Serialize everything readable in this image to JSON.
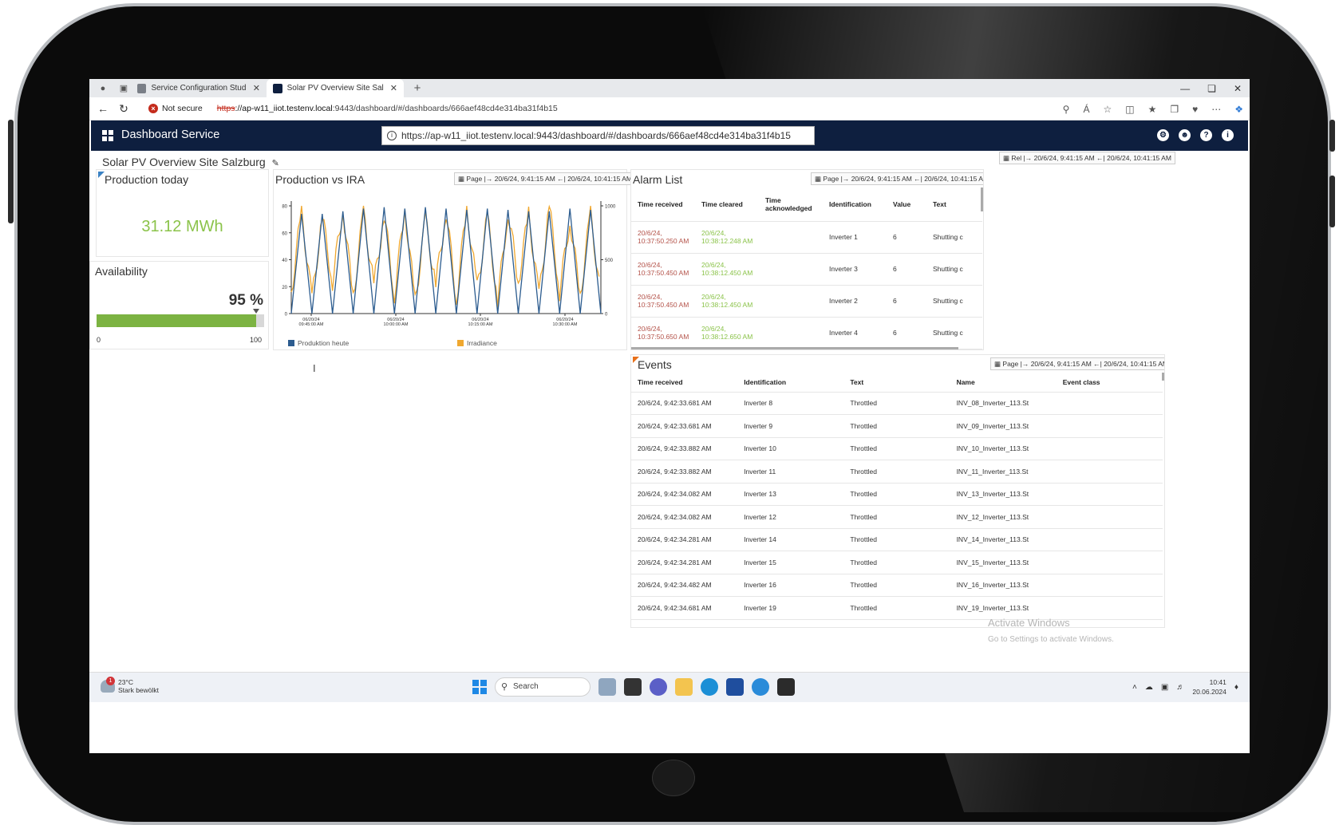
{
  "browser": {
    "tabs": [
      {
        "label": "Service Configuration Studio - lio",
        "active": false
      },
      {
        "label": "Solar PV Overview Site Salzburg",
        "active": true
      }
    ],
    "new_tab": "+",
    "not_secure": "Not secure",
    "url_scheme": "https",
    "url_host": "://ap-w11_iiot.testenv.local",
    "url_rest": ":9443/dashboard/#/dashboards/666aef48cd4e314ba31f4b15"
  },
  "app": {
    "title": "Dashboard Service",
    "url_popup": "https://ap-w11_iiot.testenv.local:9443/dashboard/#/dashboards/666aef48cd4e314ba31f4b15",
    "page_title": "Solar PV Overview Site Salzburg",
    "global_range": "Rel |→ 20/6/24, 9:41:15 AM ←| 20/6/24, 10:41:15 AM"
  },
  "production_today": {
    "title": "Production today",
    "value": "31.12 MWh"
  },
  "availability": {
    "title": "Availability",
    "value": "95 %",
    "percent": 95,
    "min": "0",
    "max": "100"
  },
  "production_chart": {
    "title": "Production vs IRA",
    "range": "Page |→ 20/6/24, 9:41:15 AM ←| 20/6/24, 10:41:15 AM"
  },
  "chart_data": {
    "type": "line",
    "title": "Production vs IRA",
    "x_ticks": [
      "06/20/24 09:45:00 AM",
      "06/20/24 10:00:00 AM",
      "06/20/24 10:15:00 AM",
      "06/20/24 10:30:00 AM"
    ],
    "y_left_ticks": [
      "0",
      "20",
      "40",
      "60",
      "80"
    ],
    "y_right_ticks": [
      "0",
      "500",
      "1000"
    ],
    "y_left_range": [
      0,
      80
    ],
    "y_right_range": [
      0,
      1000
    ],
    "series": [
      {
        "name": "Produktion heute",
        "color": "#2c5c8f",
        "axis": "left",
        "values": [
          0,
          74,
          0,
          74,
          0,
          76,
          0,
          78,
          0,
          79,
          0,
          78,
          0,
          79,
          0,
          78,
          0,
          77,
          0,
          78,
          0,
          77,
          0,
          76,
          0,
          76,
          0,
          78,
          0,
          77,
          0
        ]
      },
      {
        "name": "Irradiance",
        "color": "#f0a830",
        "axis": "right",
        "values": [
          200,
          950,
          120,
          900,
          300,
          980,
          150,
          950,
          250,
          920,
          180,
          980,
          100,
          870,
          260,
          960,
          140,
          990,
          220,
          900,
          110,
          960,
          300,
          920,
          150,
          1000,
          200,
          880,
          160,
          940,
          120
        ]
      }
    ],
    "legend_position": "bottom",
    "grid": false
  },
  "alarm_list": {
    "title": "Alarm List",
    "range": "Page |→ 20/6/24, 9:41:15 AM ←| 20/6/24, 10:41:15 AM",
    "columns": [
      "Time received",
      "Time cleared",
      "Time acknowledged",
      "Identification",
      "Value",
      "Text"
    ],
    "rows": [
      {
        "received": "20/6/24, 10:37:50.250 AM",
        "cleared": "20/6/24, 10:38:12.248 AM",
        "ack": "",
        "id": "Inverter 1",
        "value": "6",
        "text": "Shutting c"
      },
      {
        "received": "20/6/24, 10:37:50.450 AM",
        "cleared": "20/6/24, 10:38:12.450 AM",
        "ack": "",
        "id": "Inverter 3",
        "value": "6",
        "text": "Shutting c"
      },
      {
        "received": "20/6/24, 10:37:50.450 AM",
        "cleared": "20/6/24, 10:38:12.450 AM",
        "ack": "",
        "id": "Inverter 2",
        "value": "6",
        "text": "Shutting c"
      },
      {
        "received": "20/6/24, 10:37:50.650 AM",
        "cleared": "20/6/24, 10:38:12.650 AM",
        "ack": "",
        "id": "Inverter 4",
        "value": "6",
        "text": "Shutting c"
      }
    ]
  },
  "events": {
    "title": "Events",
    "range": "Page |→ 20/6/24, 9:41:15 AM ←| 20/6/24, 10:41:15 AM",
    "columns": [
      "Time received",
      "Identification",
      "Text",
      "Name",
      "Event class"
    ],
    "rows": [
      {
        "time": "20/6/24, 9:42:33.681 AM",
        "id": "Inverter 8",
        "text": "Throttled",
        "name": "INV_08_Inverter_113.St",
        "cls": ""
      },
      {
        "time": "20/6/24, 9:42:33.681 AM",
        "id": "Inverter 9",
        "text": "Throttled",
        "name": "INV_09_Inverter_113.St",
        "cls": ""
      },
      {
        "time": "20/6/24, 9:42:33.882 AM",
        "id": "Inverter 10",
        "text": "Throttled",
        "name": "INV_10_Inverter_113.St",
        "cls": ""
      },
      {
        "time": "20/6/24, 9:42:33.882 AM",
        "id": "Inverter 11",
        "text": "Throttled",
        "name": "INV_11_Inverter_113.St",
        "cls": ""
      },
      {
        "time": "20/6/24, 9:42:34.082 AM",
        "id": "Inverter 13",
        "text": "Throttled",
        "name": "INV_13_Inverter_113.St",
        "cls": ""
      },
      {
        "time": "20/6/24, 9:42:34.082 AM",
        "id": "Inverter 12",
        "text": "Throttled",
        "name": "INV_12_Inverter_113.St",
        "cls": ""
      },
      {
        "time": "20/6/24, 9:42:34.281 AM",
        "id": "Inverter 14",
        "text": "Throttled",
        "name": "INV_14_Inverter_113.St",
        "cls": ""
      },
      {
        "time": "20/6/24, 9:42:34.281 AM",
        "id": "Inverter 15",
        "text": "Throttled",
        "name": "INV_15_Inverter_113.St",
        "cls": ""
      },
      {
        "time": "20/6/24, 9:42:34.482 AM",
        "id": "Inverter 16",
        "text": "Throttled",
        "name": "INV_16_Inverter_113.St",
        "cls": ""
      },
      {
        "time": "20/6/24, 9:42:34.681 AM",
        "id": "Inverter 19",
        "text": "Throttled",
        "name": "INV_19_Inverter_113.St",
        "cls": ""
      }
    ]
  },
  "watermark": {
    "line1": "Activate Windows",
    "line2": "Go to Settings to activate Windows."
  },
  "taskbar": {
    "weather_temp": "23°C",
    "weather_desc": "Stark bewölkt",
    "weather_badge": "1",
    "search": "Search",
    "time": "10:41",
    "date": "20.06.2024"
  }
}
